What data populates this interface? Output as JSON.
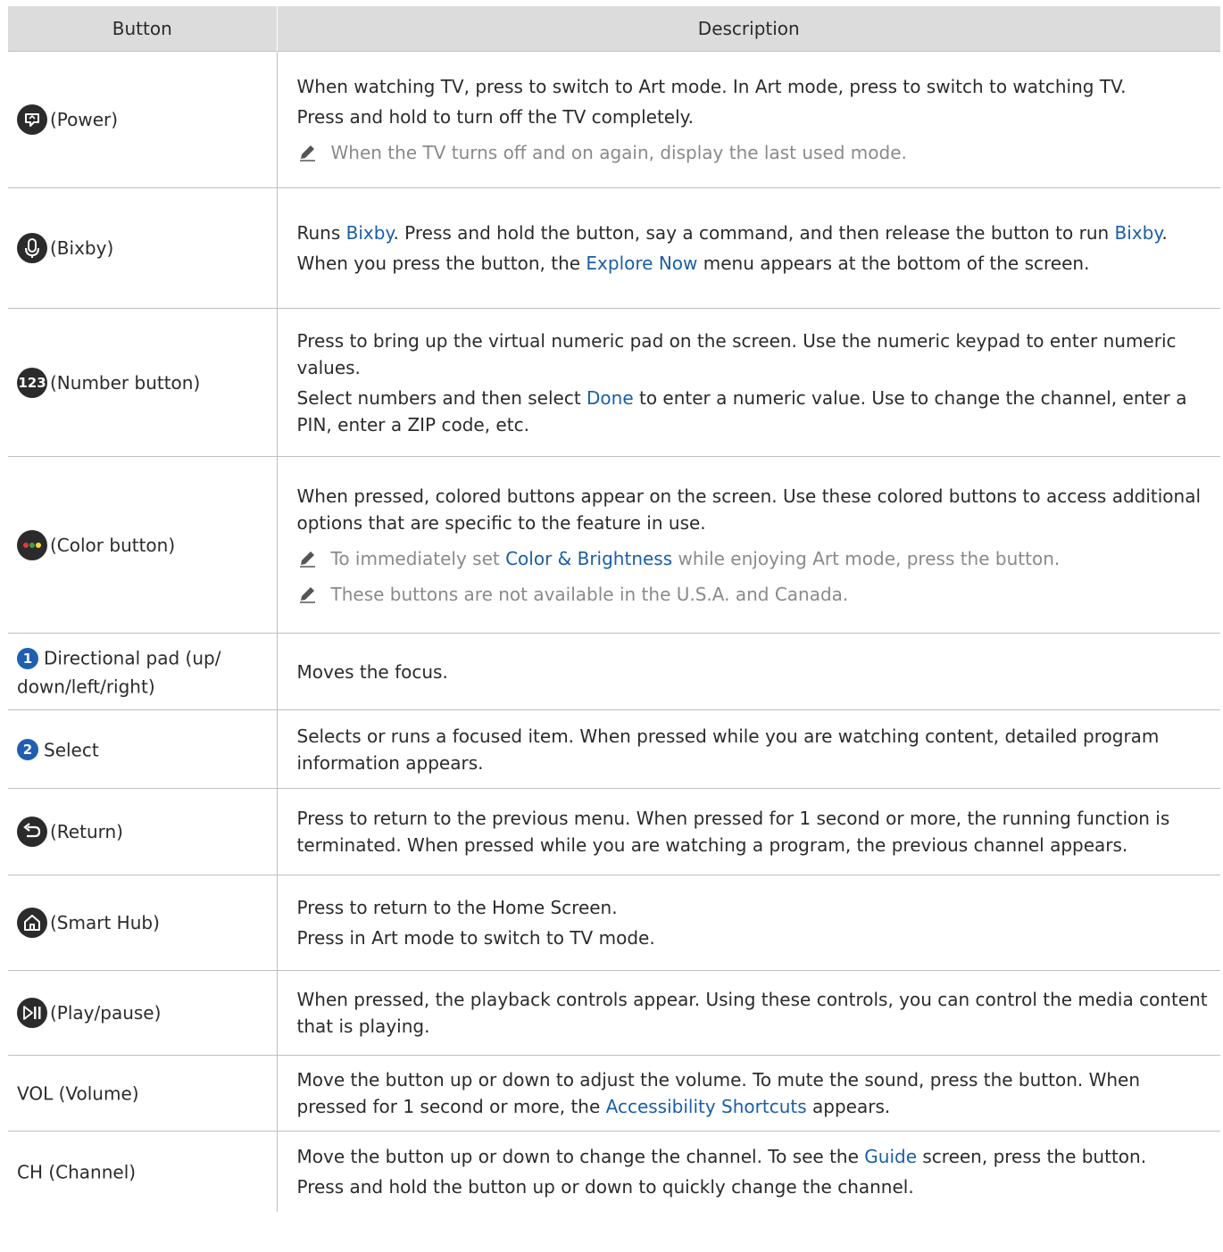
{
  "headers": {
    "button": "Button",
    "description": "Description"
  },
  "rows": [
    {
      "label": "(Power)",
      "p": [
        "When watching TV, press to switch to Art mode. In Art mode, press to switch to watching TV.",
        "Press and hold to turn off the TV completely."
      ],
      "note": "When the TV turns off and on again, display the last used mode."
    },
    {
      "label": "(Bixby)",
      "p1": {
        "a": "Runs ",
        "hl1": "Bixby",
        "b": ". Press and hold the button, say a command, and then release the button to run ",
        "hl2": "Bixby",
        "c": "."
      },
      "p2": {
        "a": "When you press the button, the ",
        "hl": "Explore Now",
        "b": " menu appears at the bottom of the screen."
      }
    },
    {
      "label": "(Number button)",
      "icon_text": "123",
      "p1": "Press to bring up the virtual numeric pad on the screen. Use the numeric keypad to enter numeric values.",
      "p2": {
        "a": "Select numbers and then select ",
        "hl": "Done",
        "b": " to enter a numeric value. Use to change the channel, enter a PIN, enter a ZIP code, etc."
      }
    },
    {
      "label": "(Color button)",
      "p": "When pressed, colored buttons appear on the screen. Use these colored buttons to access additional options that are specific to the feature in use.",
      "note1": {
        "a": "To immediately set ",
        "hl": "Color & Brightness",
        "b": " while enjoying Art mode, press the button."
      },
      "note2": "These buttons are not available in the U.S.A. and Canada."
    },
    {
      "badge": "1",
      "label": "Directional pad (up/ down/left/right)",
      "p": "Moves the focus."
    },
    {
      "badge": "2",
      "label": "Select",
      "p": "Selects or runs a focused item. When pressed while you are watching content, detailed program information appears."
    },
    {
      "label": "(Return)",
      "p": "Press to return to the previous menu. When pressed for 1 second or more, the running function is terminated. When pressed while you are watching a program, the previous channel appears."
    },
    {
      "label": "(Smart Hub)",
      "p": [
        "Press to return to the Home Screen.",
        "Press in Art mode to switch to TV mode."
      ]
    },
    {
      "label": "(Play/pause)",
      "p": "When pressed, the playback controls appear. Using these controls, you can control the media content that is playing."
    },
    {
      "label": "VOL (Volume)",
      "p": {
        "a": "Move the button up or down to adjust the volume. To mute the sound, press the button. When pressed for 1 second or more, the ",
        "hl": "Accessibility Shortcuts",
        "b": " appears."
      }
    },
    {
      "label": "CH (Channel)",
      "p1": {
        "a": "Move the button up or down to change the channel. To see the ",
        "hl": "Guide",
        "b": " screen, press the button."
      },
      "p2": "Press and hold the button up or down to quickly change the channel."
    }
  ],
  "colors": {
    "header_bg": "#dcdcdc",
    "highlight": "#1a5ea8",
    "badge": "#1f5fb0",
    "icon": "#2b2b2b",
    "note_text": "#8a8a8a"
  },
  "icons": [
    "art-power-icon",
    "microphone-icon",
    "number-123-icon",
    "color-dots-icon",
    "return-arrow-icon",
    "home-icon",
    "play-pause-icon",
    "pencil-note-icon"
  ]
}
